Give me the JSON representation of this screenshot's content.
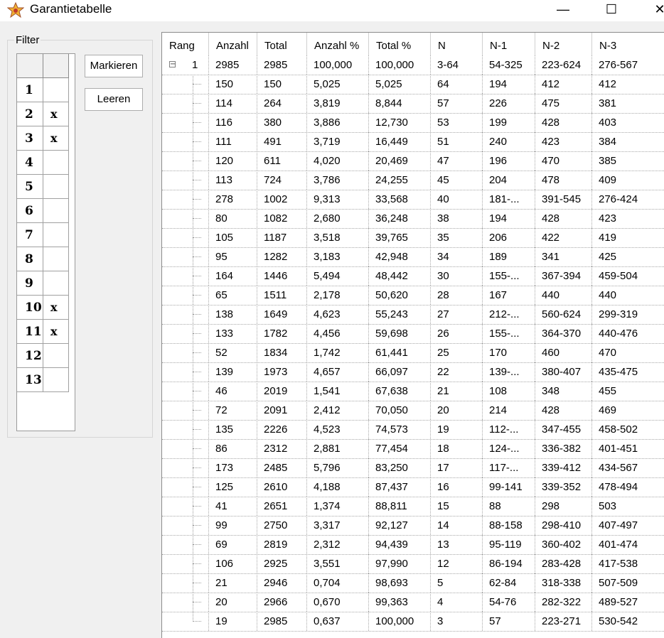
{
  "window": {
    "title": "Garantietabelle",
    "icon": "star-app-icon",
    "minimize": "—",
    "maximize": "☐",
    "close": "✕"
  },
  "filter": {
    "legend": "Filter",
    "rows": [
      {
        "num": "1",
        "mark": ""
      },
      {
        "num": "2",
        "mark": "x"
      },
      {
        "num": "3",
        "mark": "x"
      },
      {
        "num": "4",
        "mark": ""
      },
      {
        "num": "5",
        "mark": ""
      },
      {
        "num": "6",
        "mark": ""
      },
      {
        "num": "7",
        "mark": ""
      },
      {
        "num": "8",
        "mark": ""
      },
      {
        "num": "9",
        "mark": ""
      },
      {
        "num": "10",
        "mark": "x"
      },
      {
        "num": "11",
        "mark": "x"
      },
      {
        "num": "12",
        "mark": ""
      },
      {
        "num": "13",
        "mark": ""
      }
    ],
    "mark_button": "Markieren",
    "clear_button": "Leeren"
  },
  "table": {
    "columns": [
      "Rang",
      "Anzahl",
      "Total",
      "Anzahl %",
      "Total %",
      "N",
      "N-1",
      "N-2",
      "N-3"
    ],
    "root": {
      "expander": "−",
      "rank": "1",
      "cells": [
        "2985",
        "2985",
        "100,000",
        "100,000",
        "3-64",
        "54-325",
        "223-624",
        "276-567"
      ]
    },
    "rows": [
      [
        "150",
        "150",
        "5,025",
        "5,025",
        "64",
        "194",
        "412",
        "412"
      ],
      [
        "114",
        "264",
        "3,819",
        "8,844",
        "57",
        "226",
        "475",
        "381"
      ],
      [
        "116",
        "380",
        "3,886",
        "12,730",
        "53",
        "199",
        "428",
        "403"
      ],
      [
        "111",
        "491",
        "3,719",
        "16,449",
        "51",
        "240",
        "423",
        "384"
      ],
      [
        "120",
        "611",
        "4,020",
        "20,469",
        "47",
        "196",
        "470",
        "385"
      ],
      [
        "113",
        "724",
        "3,786",
        "24,255",
        "45",
        "204",
        "478",
        "409"
      ],
      [
        "278",
        "1002",
        "9,313",
        "33,568",
        "40",
        "181-...",
        "391-545",
        "276-424"
      ],
      [
        "80",
        "1082",
        "2,680",
        "36,248",
        "38",
        "194",
        "428",
        "423"
      ],
      [
        "105",
        "1187",
        "3,518",
        "39,765",
        "35",
        "206",
        "422",
        "419"
      ],
      [
        "95",
        "1282",
        "3,183",
        "42,948",
        "34",
        "189",
        "341",
        "425"
      ],
      [
        "164",
        "1446",
        "5,494",
        "48,442",
        "30",
        "155-...",
        "367-394",
        "459-504"
      ],
      [
        "65",
        "1511",
        "2,178",
        "50,620",
        "28",
        "167",
        "440",
        "440"
      ],
      [
        "138",
        "1649",
        "4,623",
        "55,243",
        "27",
        "212-...",
        "560-624",
        "299-319"
      ],
      [
        "133",
        "1782",
        "4,456",
        "59,698",
        "26",
        "155-...",
        "364-370",
        "440-476"
      ],
      [
        "52",
        "1834",
        "1,742",
        "61,441",
        "25",
        "170",
        "460",
        "470"
      ],
      [
        "139",
        "1973",
        "4,657",
        "66,097",
        "22",
        "139-...",
        "380-407",
        "435-475"
      ],
      [
        "46",
        "2019",
        "1,541",
        "67,638",
        "21",
        "108",
        "348",
        "455"
      ],
      [
        "72",
        "2091",
        "2,412",
        "70,050",
        "20",
        "214",
        "428",
        "469"
      ],
      [
        "135",
        "2226",
        "4,523",
        "74,573",
        "19",
        "112-...",
        "347-455",
        "458-502"
      ],
      [
        "86",
        "2312",
        "2,881",
        "77,454",
        "18",
        "124-...",
        "336-382",
        "401-451"
      ],
      [
        "173",
        "2485",
        "5,796",
        "83,250",
        "17",
        "117-...",
        "339-412",
        "434-567"
      ],
      [
        "125",
        "2610",
        "4,188",
        "87,437",
        "16",
        "99-141",
        "339-352",
        "478-494"
      ],
      [
        "41",
        "2651",
        "1,374",
        "88,811",
        "15",
        "88",
        "298",
        "503"
      ],
      [
        "99",
        "2750",
        "3,317",
        "92,127",
        "14",
        "88-158",
        "298-410",
        "407-497"
      ],
      [
        "69",
        "2819",
        "2,312",
        "94,439",
        "13",
        "95-119",
        "360-402",
        "401-474"
      ],
      [
        "106",
        "2925",
        "3,551",
        "97,990",
        "12",
        "86-194",
        "283-428",
        "417-538"
      ],
      [
        "21",
        "2946",
        "0,704",
        "98,693",
        "5",
        "62-84",
        "318-338",
        "507-509"
      ],
      [
        "20",
        "2966",
        "0,670",
        "99,363",
        "4",
        "54-76",
        "282-322",
        "489-527"
      ],
      [
        "19",
        "2985",
        "0,637",
        "100,000",
        "3",
        "57",
        "223-271",
        "530-542"
      ]
    ]
  }
}
